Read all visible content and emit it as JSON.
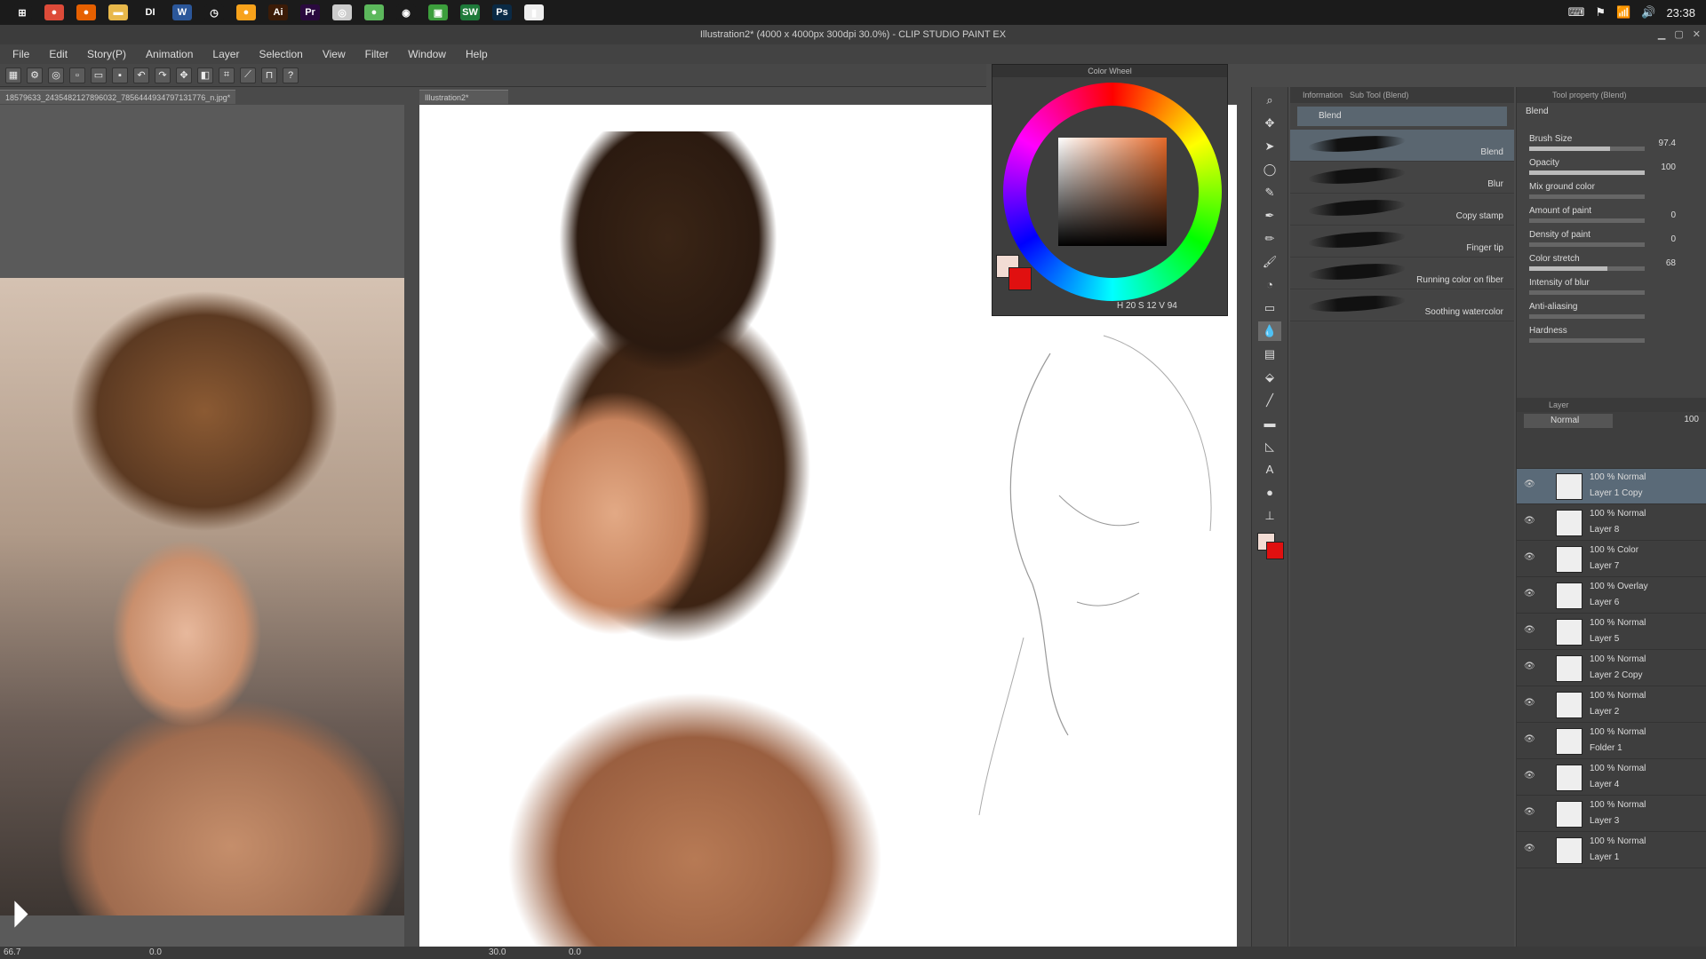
{
  "taskbar": {
    "icons": [
      {
        "name": "windows-start-icon",
        "glyph": "⊞",
        "color": "#1b1b1b"
      },
      {
        "name": "chrome-icon",
        "glyph": "●",
        "color": "#dd4b39"
      },
      {
        "name": "firefox-icon",
        "glyph": "●",
        "color": "#e66000"
      },
      {
        "name": "folder-icon",
        "glyph": "▬",
        "color": "#e8b84a"
      },
      {
        "name": "di-icon",
        "glyph": "DI",
        "color": "#1b1b1b"
      },
      {
        "name": "word-icon",
        "glyph": "W",
        "color": "#2b579a"
      },
      {
        "name": "clock-app-icon",
        "glyph": "◷",
        "color": "#1b1b1b"
      },
      {
        "name": "app-orange-icon",
        "glyph": "●",
        "color": "#f7a21b"
      },
      {
        "name": "illustrator-icon",
        "glyph": "Ai",
        "color": "#3b1b07"
      },
      {
        "name": "premiere-icon",
        "glyph": "Pr",
        "color": "#2a0a3e"
      },
      {
        "name": "clip-studio-icon",
        "glyph": "◎",
        "color": "#cccccc"
      },
      {
        "name": "green-app-icon",
        "glyph": "●",
        "color": "#5cb85c"
      },
      {
        "name": "maps-icon",
        "glyph": "◉",
        "color": "#1b1b1b"
      },
      {
        "name": "green-square-icon",
        "glyph": "▣",
        "color": "#3c9e3c"
      },
      {
        "name": "sw-icon",
        "glyph": "SW",
        "color": "#1e7a3a"
      },
      {
        "name": "photoshop-icon",
        "glyph": "Ps",
        "color": "#0a2a45"
      },
      {
        "name": "white-app-icon",
        "glyph": "▮",
        "color": "#eeeeee"
      }
    ],
    "clock": "23:38"
  },
  "window": {
    "title": "Illustration2* (4000 x 4000px 300dpi 30.0%)  - CLIP STUDIO PAINT EX"
  },
  "menu": [
    "File",
    "Edit",
    "Story(P)",
    "Animation",
    "Layer",
    "Selection",
    "View",
    "Filter",
    "Window",
    "Help"
  ],
  "tabs": {
    "reference": "18579633_2435482127896032_7856444934797131776_n.jpg*",
    "canvas": "Illustration2*"
  },
  "colorwheel": {
    "title": "Color Wheel",
    "h_label": "H",
    "h": "20",
    "s_label": "S",
    "s": "12",
    "v_label": "V",
    "v": "94",
    "accent": "#e66a2a"
  },
  "subtool": {
    "tabs": [
      "Information",
      "Sub Tool (Blend)"
    ],
    "group": "Blend",
    "brushes": [
      "Blend",
      "Blur",
      "Copy stamp",
      "Finger tip",
      "Running color on fiber",
      "Soothing watercolor"
    ]
  },
  "toolprop": {
    "tab": "Tool property (Blend)",
    "name": "Blend",
    "props": [
      {
        "name": "Brush Size",
        "value": "97.4",
        "fill": 0.7
      },
      {
        "name": "Opacity",
        "value": "100",
        "fill": 1.0
      },
      {
        "name": "Mix ground color",
        "value": "",
        "fill": 0
      },
      {
        "name": "Amount of paint",
        "value": "0",
        "fill": 0
      },
      {
        "name": "Density of paint",
        "value": "0",
        "fill": 0
      },
      {
        "name": "Color stretch",
        "value": "68",
        "fill": 0.68
      },
      {
        "name": "Intensity of blur",
        "value": "",
        "fill": 0
      },
      {
        "name": "Anti-aliasing",
        "value": "",
        "fill": 0
      },
      {
        "name": "Hardness",
        "value": "",
        "fill": 0
      }
    ]
  },
  "layerpanel": {
    "tab": "Layer",
    "blend": "Normal",
    "opacity": "100",
    "layers": [
      {
        "mode": "100 % Normal",
        "name": "Layer 1 Copy",
        "active": true
      },
      {
        "mode": "100 % Normal",
        "name": "Layer 8",
        "active": false
      },
      {
        "mode": "100 % Color",
        "name": "Layer 7",
        "active": false
      },
      {
        "mode": "100 % Overlay",
        "name": "Layer 6",
        "active": false
      },
      {
        "mode": "100 % Normal",
        "name": "Layer 5",
        "active": false
      },
      {
        "mode": "100 % Normal",
        "name": "Layer 2 Copy",
        "active": false
      },
      {
        "mode": "100 % Normal",
        "name": "Layer 2",
        "active": false
      },
      {
        "mode": "100 % Normal",
        "name": "Folder 1",
        "active": false
      },
      {
        "mode": "100 % Normal",
        "name": "Layer 4",
        "active": false
      },
      {
        "mode": "100 % Normal",
        "name": "Layer 3",
        "active": false
      },
      {
        "mode": "100 % Normal",
        "name": "Layer 1",
        "active": false
      }
    ]
  },
  "status": {
    "left_zoom": "66.7",
    "left_angle": "0.0",
    "canvas_zoom": "30.0",
    "canvas_angle": "0.0"
  }
}
